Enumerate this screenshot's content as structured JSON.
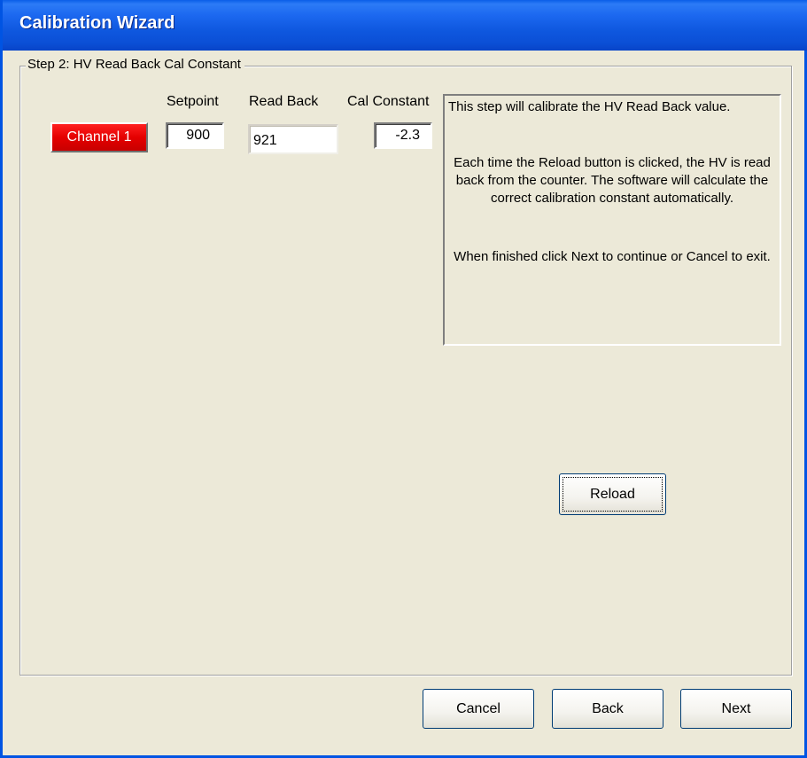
{
  "window": {
    "title": "Calibration Wizard"
  },
  "step": {
    "legend": "Step 2:  HV Read Back Cal Constant",
    "headers": {
      "setpoint": "Setpoint",
      "read_back": "Read Back",
      "cal_constant": "Cal Constant"
    },
    "channel": {
      "label": "Channel 1",
      "color": "#e40000"
    },
    "values": {
      "setpoint": "900",
      "read_back": "921",
      "cal_constant": "-2.3"
    },
    "info": {
      "line1": "This step will calibrate the HV Read Back value.",
      "para2": "Each time the Reload button is clicked, the HV is read back from the counter.  The software will calculate the correct calibration constant automatically.",
      "para3": "When finished click Next to continue or Cancel to exit."
    },
    "reload_label": "Reload"
  },
  "footer": {
    "cancel_label": "Cancel",
    "back_label": "Back",
    "next_label": "Next"
  },
  "colors": {
    "titlebar": "#0b4fd6",
    "dialog_bg": "#ece9d8",
    "button_border": "#003c74"
  }
}
